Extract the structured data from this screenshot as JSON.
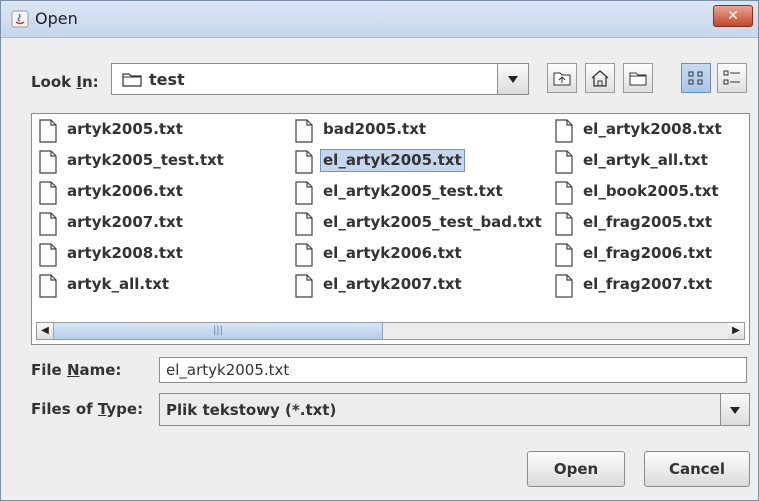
{
  "window": {
    "title": "Open",
    "close_glyph": "✕"
  },
  "look_in": {
    "label_prefix": "Look ",
    "label_key": "I",
    "label_suffix": "n:",
    "value": "test"
  },
  "toolbar": {
    "icons": [
      "up-one-level-icon",
      "home-icon",
      "new-folder-icon",
      "list-view-icon",
      "details-view-icon"
    ],
    "selected": "list-view-icon"
  },
  "files": {
    "columns": [
      [
        "artyk2005.txt",
        "artyk2005_test.txt",
        "artyk2006.txt",
        "artyk2007.txt",
        "artyk2008.txt",
        "artyk_all.txt"
      ],
      [
        "bad2005.txt",
        "el_artyk2005.txt",
        "el_artyk2005_test.txt",
        "el_artyk2005_test_bad.txt",
        "el_artyk2006.txt",
        "el_artyk2007.txt"
      ],
      [
        "el_artyk2008.txt",
        "el_artyk_all.txt",
        "el_book2005.txt",
        "el_frag2005.txt",
        "el_frag2006.txt",
        "el_frag2007.txt"
      ]
    ],
    "selected": "el_artyk2005.txt"
  },
  "scrollbar": {
    "left_arrow": "◀",
    "right_arrow": "▶",
    "thumb_grip": "|||"
  },
  "file_name": {
    "label_prefix": "File ",
    "label_key": "N",
    "label_suffix": "ame:",
    "value": "el_artyk2005.txt"
  },
  "file_type": {
    "label_prefix": "Files of ",
    "label_key": "T",
    "label_suffix": "ype:",
    "value": "Plik tekstowy (*.txt)"
  },
  "buttons": {
    "open": "Open",
    "cancel": "Cancel"
  }
}
